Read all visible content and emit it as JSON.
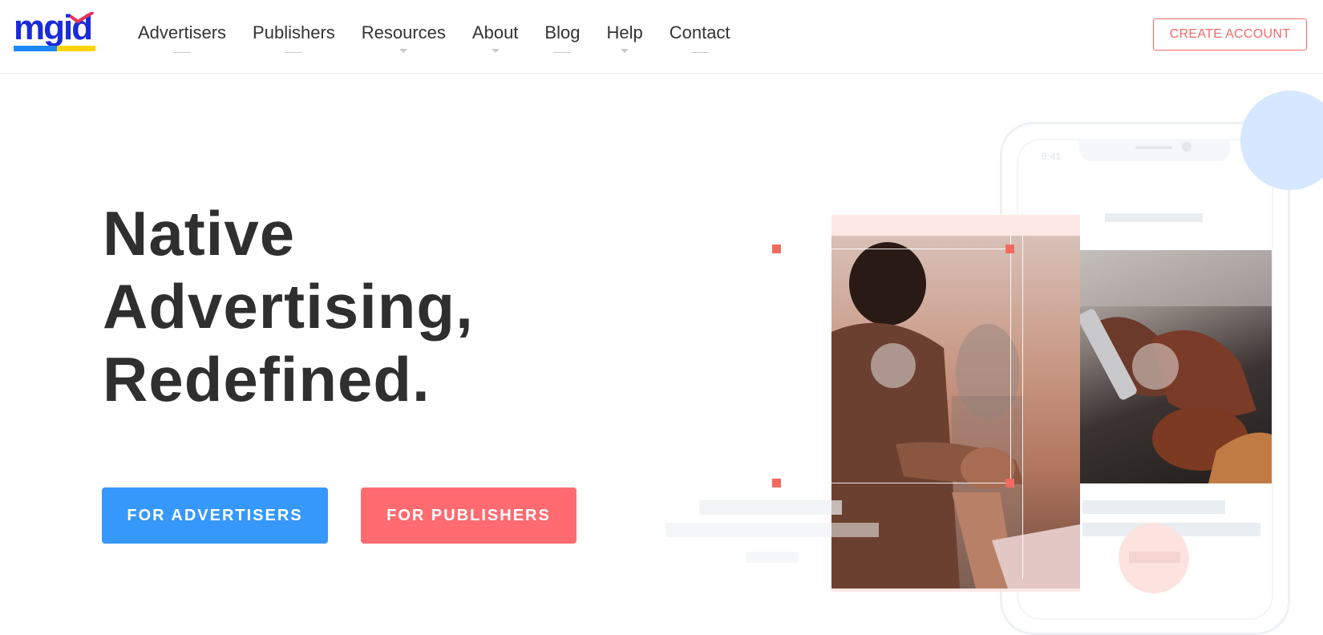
{
  "header": {
    "logo": {
      "text": "mgid",
      "colors": {
        "word": "#1b2bd8",
        "bar_left": "#1e88f5",
        "bar_right": "#ffd400",
        "tick": "#e8325a"
      }
    },
    "nav": [
      {
        "label": "Advertisers",
        "indicator": "line"
      },
      {
        "label": "Publishers",
        "indicator": "line"
      },
      {
        "label": "Resources",
        "indicator": "caret"
      },
      {
        "label": "About",
        "indicator": "caret"
      },
      {
        "label": "Blog",
        "indicator": "line"
      },
      {
        "label": "Help",
        "indicator": "caret"
      },
      {
        "label": "Contact",
        "indicator": "line"
      }
    ],
    "create_account_label": "CREATE ACCOUNT"
  },
  "hero": {
    "headline_lines": [
      "Native",
      "Advertising,",
      "Redefined."
    ],
    "buttons": {
      "advertisers_label": "FOR ADVERTISERS",
      "publishers_label": "FOR PUBLISHERS"
    }
  },
  "illustration": {
    "phone_time": "9:41"
  },
  "colors": {
    "accent_blue": "#3698fb",
    "accent_red": "#ff6b71",
    "outline_red": "#f06a6a",
    "text_dark": "#2f2f2f"
  }
}
